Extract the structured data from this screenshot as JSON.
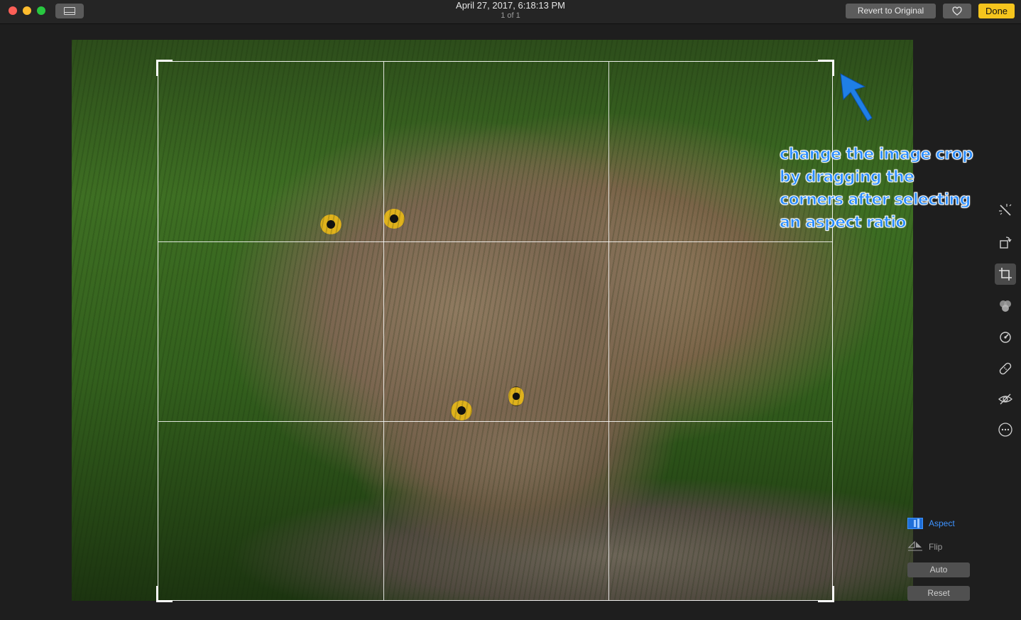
{
  "window": {
    "title_date": "April 27, 2017, 6:18:13 PM",
    "title_count": "1 of 1"
  },
  "toolbar": {
    "revert_label": "Revert to Original",
    "done_label": "Done"
  },
  "annotation": {
    "lines": [
      "change the image crop",
      "by dragging the",
      "corners after selecting",
      "an aspect ratio"
    ],
    "color": "#2a8cff"
  },
  "tools": [
    {
      "name": "enhance",
      "icon": "magic-wand-icon",
      "active": false
    },
    {
      "name": "rotate",
      "icon": "rotate-icon",
      "active": false
    },
    {
      "name": "crop",
      "icon": "crop-icon",
      "active": true
    },
    {
      "name": "filters",
      "icon": "filters-icon",
      "active": false
    },
    {
      "name": "adjust",
      "icon": "adjust-icon",
      "active": false
    },
    {
      "name": "retouch",
      "icon": "bandage-icon",
      "active": false
    },
    {
      "name": "red-eye",
      "icon": "red-eye-icon",
      "active": false
    },
    {
      "name": "more",
      "icon": "more-icon",
      "active": false
    }
  ],
  "crop_panel": {
    "aspect_label": "Aspect",
    "flip_label": "Flip",
    "auto_label": "Auto",
    "reset_label": "Reset",
    "accent": "#3e93ff"
  },
  "colors": {
    "done_button": "#f5c51d",
    "titlebar": "#252525",
    "background": "#1e1e1e"
  }
}
